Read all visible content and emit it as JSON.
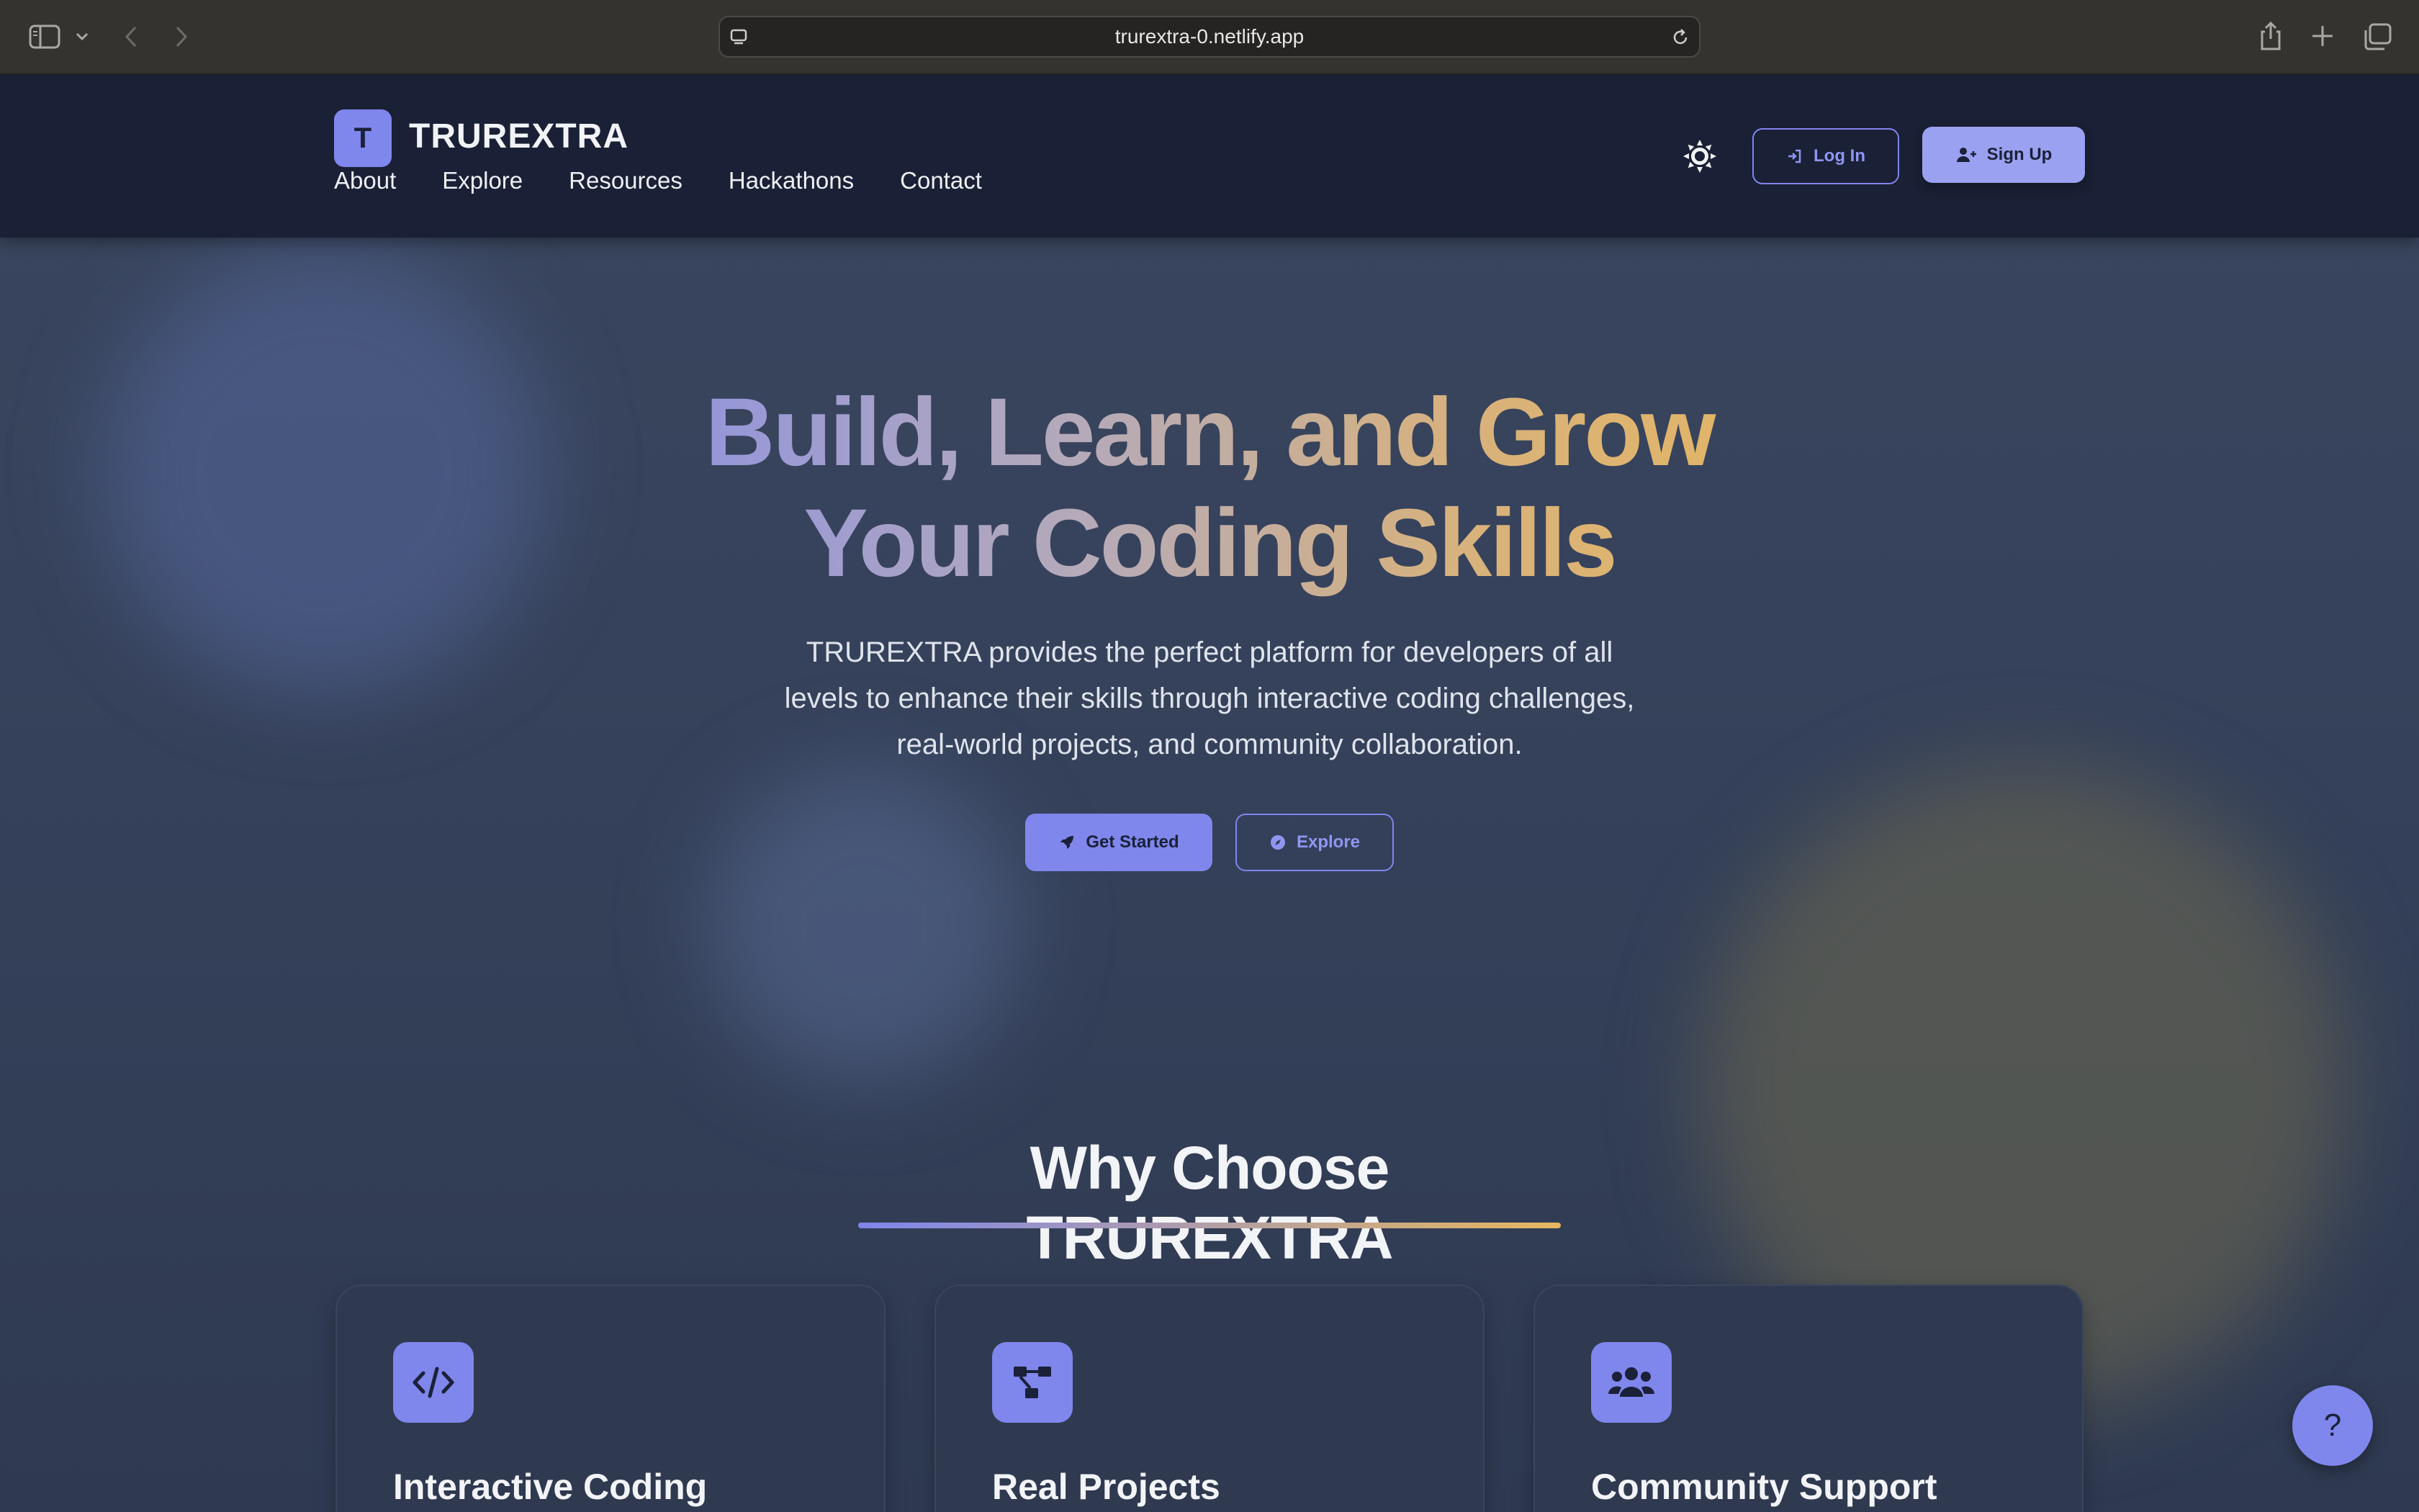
{
  "browser": {
    "url": "trurextra-0.netlify.app",
    "icons": [
      "sidebar-icon",
      "chevron-down-icon",
      "back-icon",
      "forward-icon",
      "site-settings-icon",
      "reload-icon",
      "share-icon",
      "new-tab-icon",
      "tabs-overview-icon"
    ]
  },
  "header": {
    "logo_letter": "T",
    "brand": "TRUREXTRA",
    "nav": [
      "About",
      "Explore",
      "Resources",
      "Hackathons",
      "Contact"
    ],
    "login_label": "Log In",
    "signup_label": "Sign Up"
  },
  "hero": {
    "title_line1": "Build, Learn, and Grow",
    "title_line2": "Your Coding Skills",
    "subtitle": "TRUREXTRA provides the perfect platform for developers of all levels to enhance their skills through interactive coding challenges, real-world projects, and community collaboration.",
    "get_started_label": "Get Started",
    "explore_label": "Explore"
  },
  "features": {
    "heading": "Why Choose TRUREXTRA",
    "cards": [
      {
        "title": "Interactive Coding",
        "icon": "code-icon"
      },
      {
        "title": "Real Projects",
        "icon": "project-diagram-icon"
      },
      {
        "title": "Community Support",
        "icon": "users-icon"
      }
    ]
  },
  "help": {
    "label": "?"
  },
  "colors": {
    "accent": "#7f86ec",
    "gold": "#e6b65e",
    "navbar": "#1a2035",
    "page_bg": "#36425a"
  }
}
